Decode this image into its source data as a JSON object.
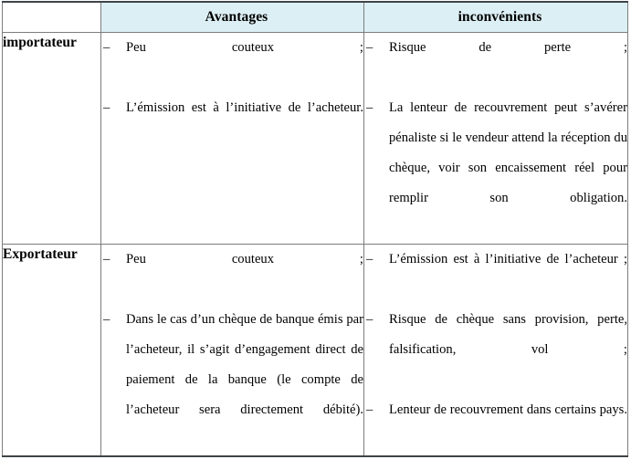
{
  "table": {
    "columns": [
      {
        "key": "party",
        "header": ""
      },
      {
        "key": "advantages",
        "header": "Avantages"
      },
      {
        "key": "drawbacks",
        "header": "inconvénients"
      }
    ],
    "header_background": "#dceff4",
    "border_color": "#7d7d7d",
    "outer_border_color": "#3f4448",
    "rows": [
      {
        "label": "importateur",
        "advantages": [
          "Peu couteux ;",
          "L’émission est à l’initiative de l’acheteur."
        ],
        "drawbacks": [
          "Risque de perte ;",
          "La lenteur de recouvrement peut s’avérer pénaliste si le vendeur attend la réception du chèque, voir son encaissement réel pour remplir son obligation."
        ]
      },
      {
        "label": "Exportateur",
        "advantages": [
          "Peu couteux ;",
          "Dans le cas d’un chèque de banque émis par l’acheteur, il s’agit d’engagement direct de paiement de la banque (le compte de l’acheteur sera directement débité)."
        ],
        "drawbacks": [
          "L’émission est à l’initiative de l’acheteur ;",
          "Risque de chèque sans provision, perte, falsification, vol ;",
          "Lenteur de recouvrement dans certains pays."
        ]
      }
    ],
    "bullet_marker": "–"
  }
}
